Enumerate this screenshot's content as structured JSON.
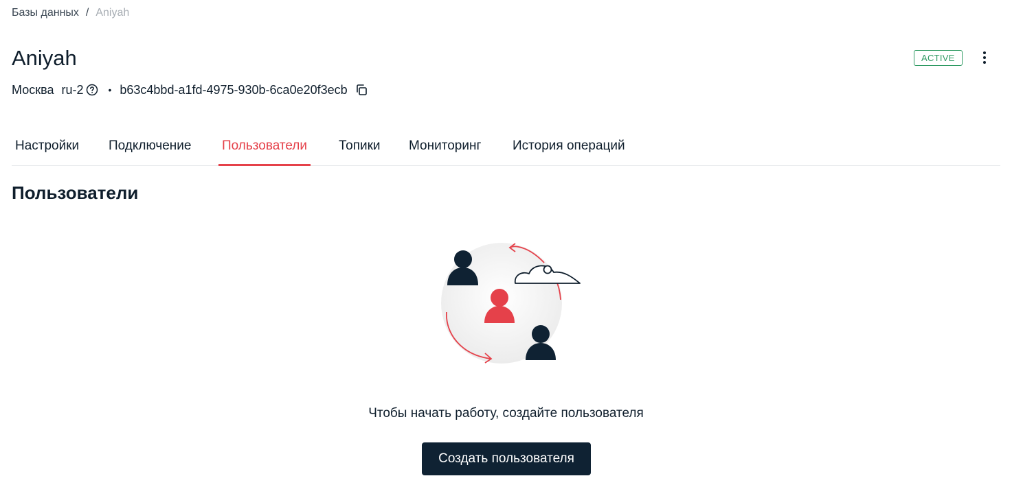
{
  "breadcrumb": {
    "parent": "Базы данных",
    "separator": "/",
    "current": "Aniyah"
  },
  "header": {
    "title": "Aniyah",
    "city": "Москва",
    "region": "ru-2",
    "separator_dot": "•",
    "instance_id": "b63c4bbd-a1fd-4975-930b-6ca0e20f3ecb",
    "status": "ACTIVE",
    "status_color": "#2f9a63",
    "help_icon": "question-circle-icon",
    "copy_icon": "copy-icon",
    "more_icon": "more-vertical-icon"
  },
  "tabs": [
    {
      "label": "Настройки",
      "active": false
    },
    {
      "label": "Подключение",
      "active": false
    },
    {
      "label": "Пользователи",
      "active": true
    },
    {
      "label": "Топики",
      "active": false
    },
    {
      "label": "Мониторинг",
      "active": false
    },
    {
      "label": "История операций",
      "active": false
    }
  ],
  "accent_color": "#e5414a",
  "main": {
    "section_title": "Пользователи",
    "empty_state_text": "Чтобы начать работу, создайте пользователя",
    "create_button_label": "Создать пользователя",
    "illustration": "users-cloud-illustration"
  }
}
